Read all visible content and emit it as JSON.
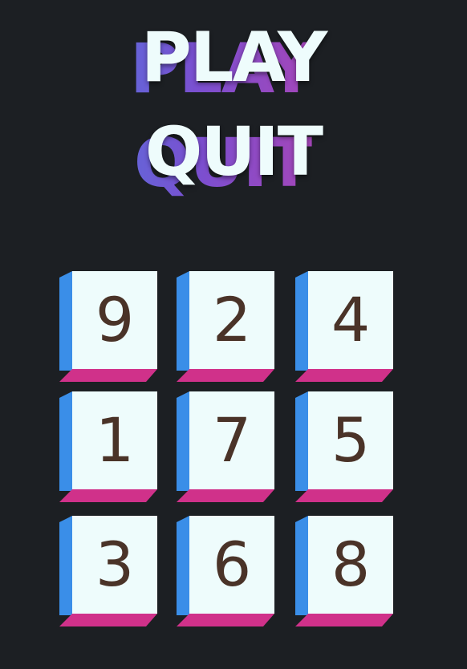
{
  "menu": {
    "play_label": "PLAY",
    "quit_label": "QUIT"
  },
  "board": {
    "tiles": [
      "9",
      "2",
      "4",
      "1",
      "7",
      "5",
      "3",
      "6",
      "8"
    ]
  },
  "colors": {
    "background": "#1c1f23",
    "tile_face": "#eefcfc",
    "tile_side": "#3a8ee8",
    "tile_bottom": "#d0318a",
    "digit": "#4a3328"
  }
}
